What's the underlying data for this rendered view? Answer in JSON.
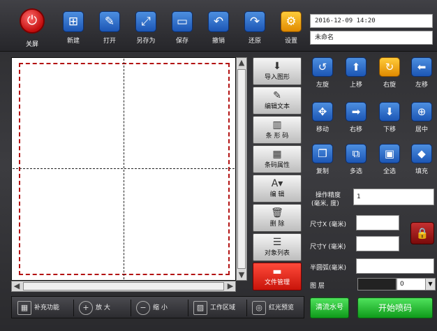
{
  "toolbar": {
    "shutdown": "关屏",
    "new": "新建",
    "open": "打开",
    "save_as": "另存为",
    "save": "保存",
    "undo": "撤销",
    "redo": "还原",
    "settings": "设置"
  },
  "status": {
    "datetime": "2016-12-09     14:20",
    "filename": "未命名"
  },
  "tools": {
    "import_graphic": "导入图形",
    "edit_text": "编辑文本",
    "barcode": "条 形 码",
    "barcode_props": "条码属性",
    "edit": "编      辑",
    "delete": "删      除",
    "object_list": "对象列表",
    "file_manage": "文件管理"
  },
  "actions": {
    "rotate_left": "左旋",
    "move_up": "上移",
    "rotate_right": "右旋",
    "move_left": "左移",
    "move": "移动",
    "move_right": "右移",
    "move_down": "下移",
    "center": "居中",
    "copy": "复制",
    "multi_select": "多选",
    "select_all": "全选",
    "fill": "填充"
  },
  "props": {
    "precision_label_1": "操作精度",
    "precision_label_2": "(毫米, 度)",
    "precision_value": "1",
    "size_x_label": "尺寸X (毫米)",
    "size_x_value": "",
    "size_y_label": "尺寸Y (毫米)",
    "size_y_value": "",
    "arc_label": "半圆弧(毫米)",
    "arc_value": "",
    "layer_label": "图   层",
    "layer_value": "0"
  },
  "bottom": {
    "supplement": "补充功能",
    "zoom_in": "放   大",
    "zoom_out": "缩   小",
    "work_area": "工作区域",
    "red_preview": "红光预览",
    "clear_serial": "清流水号",
    "start_print": "开始喷码"
  },
  "colors": {
    "accent_blue": "#2a6fd0",
    "accent_red": "#d0180c",
    "accent_green": "#22b52e"
  }
}
